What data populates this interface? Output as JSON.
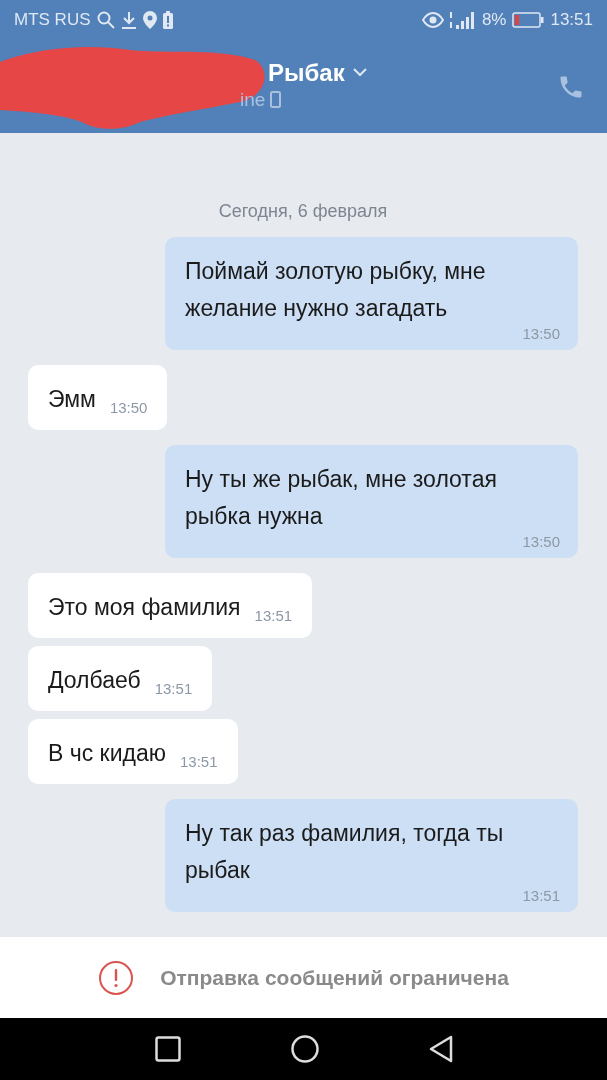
{
  "status_bar": {
    "carrier": "MTS RUS",
    "battery": "8%",
    "time": "13:51"
  },
  "header": {
    "name": "Рыбак",
    "status": "ine"
  },
  "date": "Сегодня, 6 февраля",
  "messages": [
    {
      "kind": "out",
      "text": "Поймай золотую рыбку, мне желание нужно загадать",
      "time": "13:50"
    },
    {
      "kind": "in",
      "text": "Эмм",
      "time": "13:50"
    },
    {
      "kind": "out",
      "text": "Ну ты же рыбак, мне золотая рыбка нужна",
      "time": "13:50"
    },
    {
      "kind": "in",
      "text": "Это моя фамилия",
      "time": "13:51"
    },
    {
      "kind": "in",
      "text": "Долбаеб",
      "time": "13:51"
    },
    {
      "kind": "in",
      "text": "В чс кидаю",
      "time": "13:51"
    },
    {
      "kind": "out",
      "text": "Ну так раз фамилия, тогда ты рыбак",
      "time": "13:51"
    }
  ],
  "notice": "Отправка сообщений ограничена"
}
